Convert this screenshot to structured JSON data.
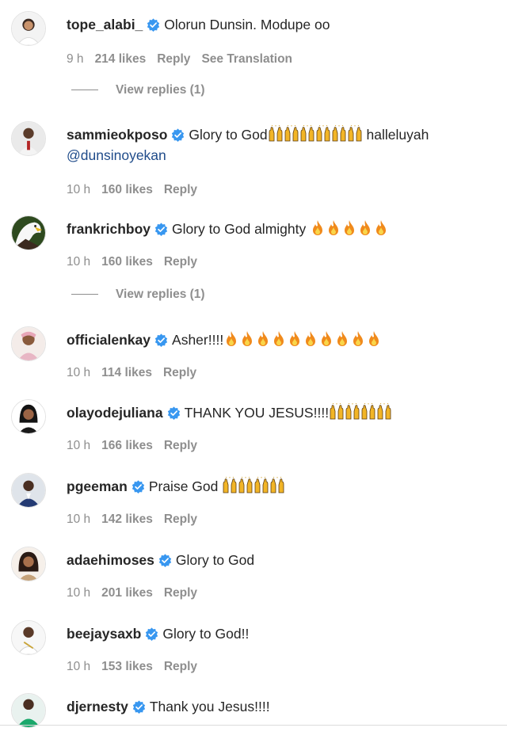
{
  "comments": [
    {
      "username": "tope_alabi_",
      "verified": true,
      "segments": [
        {
          "t": "text",
          "v": "Olorun Dunsin. Modupe oo"
        }
      ],
      "time": "9 h",
      "likes": "214 likes",
      "reply": "Reply",
      "translate": "See Translation",
      "avatar": "avatar-tope",
      "view_replies": "View replies (1)"
    },
    {
      "username": "sammieokposo",
      "verified": true,
      "segments": [
        {
          "t": "text",
          "v": "Glory to God"
        },
        {
          "t": "emoji",
          "name": "raising-hands",
          "n": 6
        },
        {
          "t": "text",
          "v": " halleluyah"
        },
        {
          "t": "mention",
          "v": "@dunsinoyekan"
        }
      ],
      "time": "10 h",
      "likes": "160 likes",
      "reply": "Reply",
      "avatar": "avatar-sammie"
    },
    {
      "username": "frankrichboy",
      "verified": true,
      "segments": [
        {
          "t": "text",
          "v": "Glory to God almighty "
        },
        {
          "t": "emoji",
          "name": "fire",
          "n": 5
        }
      ],
      "time": "10 h",
      "likes": "160 likes",
      "reply": "Reply",
      "avatar": "avatar-eagle",
      "view_replies": "View replies (1)"
    },
    {
      "username": "officialenkay",
      "verified": true,
      "segments": [
        {
          "t": "text",
          "v": "Asher!!!!"
        },
        {
          "t": "emoji",
          "name": "fire",
          "n": 10
        }
      ],
      "time": "10 h",
      "likes": "114 likes",
      "reply": "Reply",
      "avatar": "avatar-enkay"
    },
    {
      "username": "olayodejuliana",
      "verified": true,
      "segments": [
        {
          "t": "text",
          "v": "THANK YOU JESUS!!!!"
        },
        {
          "t": "emoji",
          "name": "raising-hands",
          "n": 4
        }
      ],
      "time": "10 h",
      "likes": "166 likes",
      "reply": "Reply",
      "avatar": "avatar-juliana"
    },
    {
      "username": "pgeeman",
      "verified": true,
      "segments": [
        {
          "t": "text",
          "v": "Praise God "
        },
        {
          "t": "emoji",
          "name": "raising-hands",
          "n": 4
        }
      ],
      "time": "10 h",
      "likes": "142 likes",
      "reply": "Reply",
      "avatar": "avatar-pgee"
    },
    {
      "username": "adaehimoses",
      "verified": true,
      "segments": [
        {
          "t": "text",
          "v": "Glory to God"
        }
      ],
      "time": "10 h",
      "likes": "201 likes",
      "reply": "Reply",
      "avatar": "avatar-ada"
    },
    {
      "username": "beejaysaxb",
      "verified": true,
      "segments": [
        {
          "t": "text",
          "v": "Glory to God!!"
        }
      ],
      "time": "10 h",
      "likes": "153 likes",
      "reply": "Reply",
      "avatar": "avatar-beejay"
    },
    {
      "username": "djernesty",
      "verified": true,
      "segments": [
        {
          "t": "text",
          "v": "Thank you Jesus!!!!"
        }
      ],
      "avatar": "avatar-ernesty"
    }
  ],
  "colors": {
    "verified_badge": "#3897f0",
    "meta_text": "#8e8e8e",
    "mention": "#1f4b8a",
    "fire": "#f08a1c",
    "raising_hands": "#f2b527"
  }
}
